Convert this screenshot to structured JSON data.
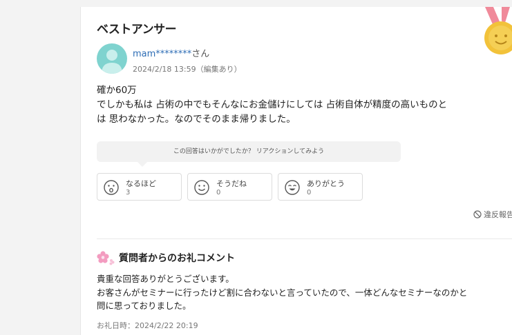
{
  "best_answer": {
    "section_title": "ベストアンサー",
    "user": {
      "name": "mam********",
      "suffix": "さん",
      "date": "2024/2/18 13:59（編集あり）"
    },
    "body": "確か60万\nでしかも私は 占術の中でもそんなにお金儲けにしては 占術自体が精度の高いものと\nは 思わなかった。なのでそのまま帰りました。",
    "reaction_prompt": "この回答はいかがでしたか？ リアクションしてみよう",
    "reactions": [
      {
        "label": "なるほど",
        "count": "3",
        "icon": "surprised-face-icon"
      },
      {
        "label": "そうだね",
        "count": "0",
        "icon": "smile-face-icon"
      },
      {
        "label": "ありがとう",
        "count": "0",
        "icon": "happy-face-icon"
      }
    ],
    "report_label": "違反報告"
  },
  "thanks": {
    "title": "質問者からのお礼コメント",
    "icon": "flower-icon",
    "body": "貴重な回答ありがとうございます。\nお客さんがセミナーに行ったけど割に合わないと言っていたので、一体どんなセミナーなのかと\n問に思っておりました。",
    "date": "お礼日時：2024/2/22 20:19"
  },
  "colors": {
    "link_blue": "#2d6db5",
    "avatar_teal": "#7fd3cf",
    "medal_gold": "#f2c23a",
    "ribbon_pink": "#f08a9a"
  }
}
